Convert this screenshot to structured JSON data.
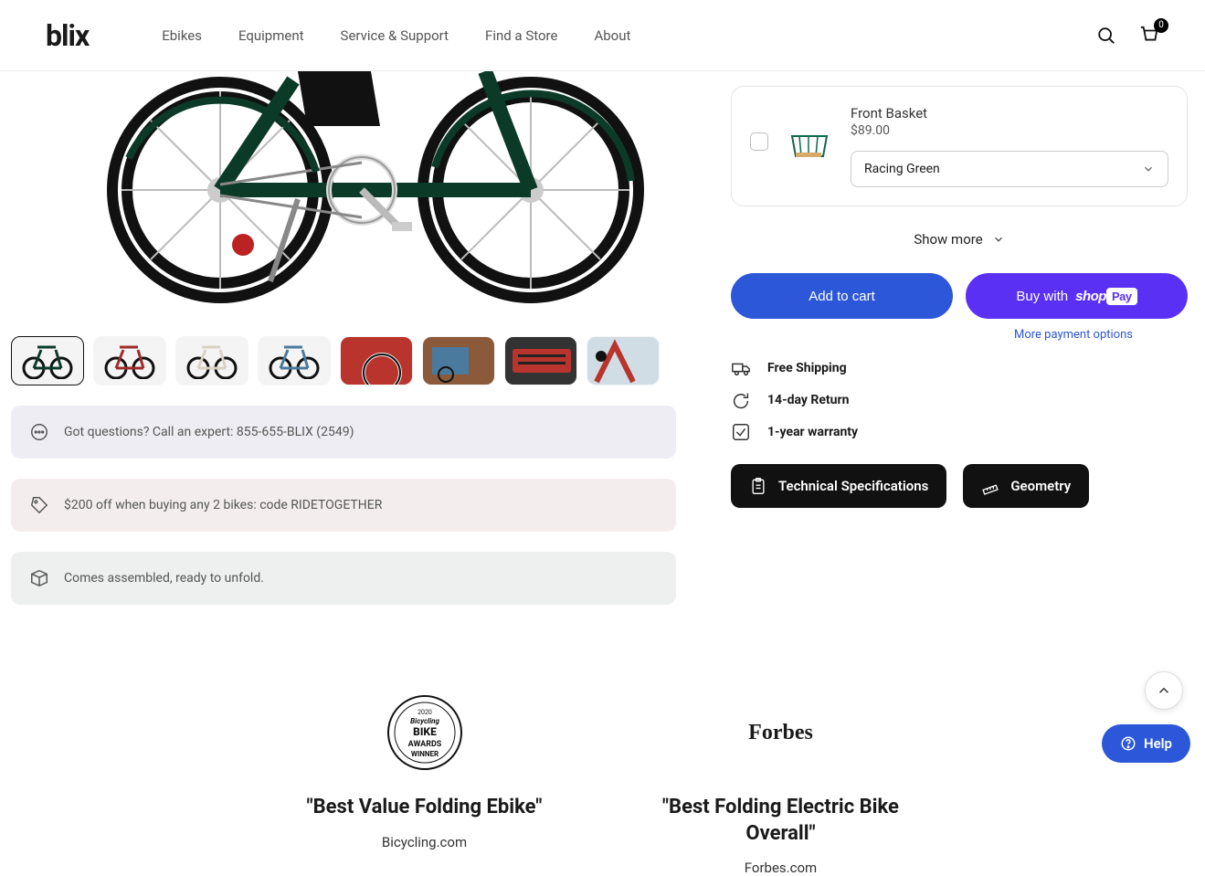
{
  "brand": "blix",
  "nav": {
    "items": [
      "Ebikes",
      "Equipment",
      "Service & Support",
      "Find a Store",
      "About"
    ]
  },
  "cart": {
    "count": "0"
  },
  "addon": {
    "name": "Front Basket",
    "price": "$89.00",
    "selected_color": "Racing Green"
  },
  "show_more_label": "Show more",
  "buttons": {
    "add_to_cart": "Add to cart",
    "buy_with": "Buy with",
    "shop": "shop",
    "pay": "Pay",
    "more_payment": "More payment options"
  },
  "benefits": {
    "shipping": "Free Shipping",
    "return": "14-day Return",
    "warranty": "1-year warranty"
  },
  "chips": {
    "specs": "Technical Specifications",
    "geometry": "Geometry"
  },
  "info_strips": {
    "questions": "Got questions? Call an expert: 855-655-BLIX (2549)",
    "promo": "$200 off when buying any 2 bikes: code RIDETOGETHER",
    "assembly": "Comes assembled, ready to unfold."
  },
  "reviews": {
    "award_year": "2020",
    "award_mag": "Bicycling",
    "award_line1": "BIKE",
    "award_line2": "AWARDS",
    "award_line3": "WINNER",
    "forbes_logo_text": "Forbes",
    "left_quote": "\"Best Value Folding Ebike\"",
    "left_source": "Bicycling.com",
    "right_quote": "\"Best Folding Electric Bike Overall\"",
    "right_source": "Forbes.com"
  },
  "help_label": "Help"
}
